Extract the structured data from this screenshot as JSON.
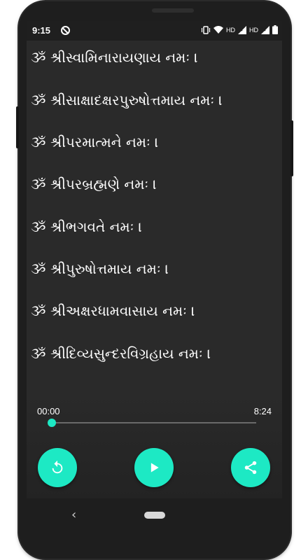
{
  "status_bar": {
    "time": "9:15",
    "network_label": "HD",
    "network_label_2": "HD"
  },
  "mantras": [
    "ૐ શ્રીસ્વામિનારાયણાય નમઃ ।",
    "ૐ શ્રીસાક્ષાદક્ષરપુરુષોત્તમાય નમઃ ।",
    "ૐ શ્રીપરમાત્મને નમઃ ।",
    "ૐ શ્રીપરબ્રહ્મણે નમઃ ।",
    "ૐ શ્રીભગવતે નમઃ ।",
    "ૐ શ્રીપુરુષોત્તમાય નમઃ ।",
    "ૐ શ્રીઅક્ષરધામવાસાય નમઃ ।",
    "ૐ શ્રીદિવ્યસુન્દરવિગ્રહાય નમઃ ।"
  ],
  "player": {
    "current_time": "00:00",
    "total_time": "8:24",
    "progress": 0,
    "accent_color": "#1de9c4"
  },
  "controls": {
    "replay_icon": "replay-icon",
    "play_icon": "play-icon",
    "share_icon": "share-icon"
  }
}
